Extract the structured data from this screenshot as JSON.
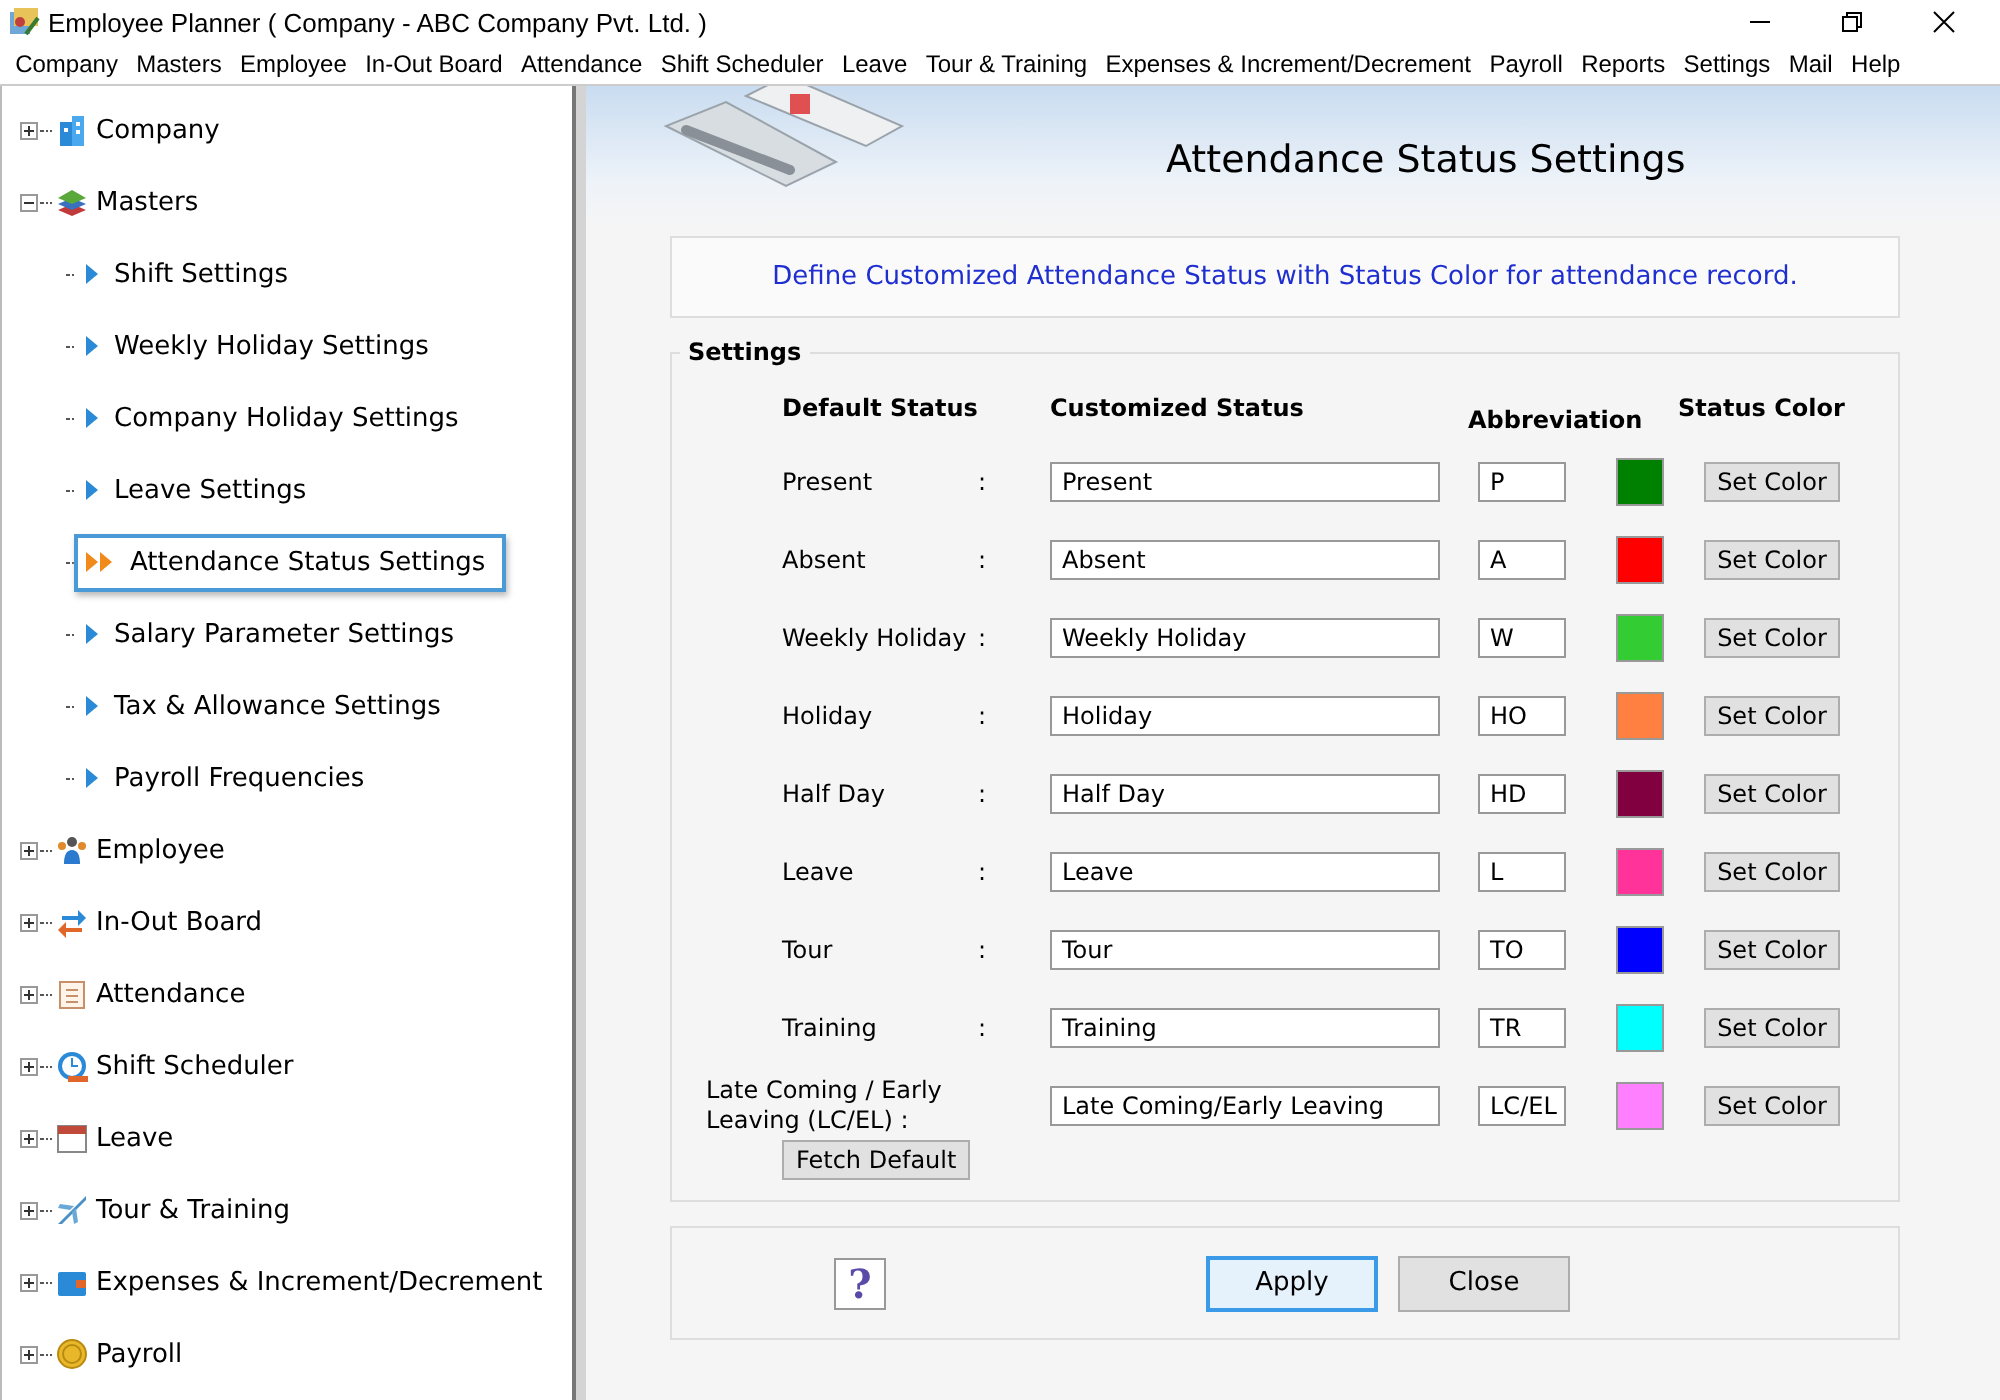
{
  "window": {
    "title": "Employee Planner ( Company - ABC Company Pvt. Ltd. )"
  },
  "menu": [
    "Company",
    "Masters",
    "Employee",
    "In-Out Board",
    "Attendance",
    "Shift Scheduler",
    "Leave",
    "Tour & Training",
    "Expenses & Increment/Decrement",
    "Payroll",
    "Reports",
    "Settings",
    "Mail",
    "Help"
  ],
  "tree": [
    {
      "label": "Company",
      "expanded": false
    },
    {
      "label": "Masters",
      "expanded": true,
      "children": [
        {
          "label": "Shift Settings",
          "selected": false
        },
        {
          "label": "Weekly Holiday Settings",
          "selected": false
        },
        {
          "label": "Company Holiday Settings",
          "selected": false
        },
        {
          "label": "Leave Settings",
          "selected": false
        },
        {
          "label": "Attendance Status Settings",
          "selected": true
        },
        {
          "label": "Salary Parameter Settings",
          "selected": false
        },
        {
          "label": "Tax & Allowance Settings",
          "selected": false
        },
        {
          "label": "Payroll Frequencies",
          "selected": false
        }
      ]
    },
    {
      "label": "Employee",
      "expanded": false
    },
    {
      "label": "In-Out Board",
      "expanded": false
    },
    {
      "label": "Attendance",
      "expanded": false
    },
    {
      "label": "Shift Scheduler",
      "expanded": false
    },
    {
      "label": "Leave",
      "expanded": false
    },
    {
      "label": "Tour & Training",
      "expanded": false
    },
    {
      "label": "Expenses & Increment/Decrement",
      "expanded": false
    },
    {
      "label": "Payroll",
      "expanded": false
    }
  ],
  "page_title": "Attendance Status Settings",
  "info": "Define Customized Attendance Status with Status Color for attendance record.",
  "settings": {
    "legend": "Settings",
    "columns": [
      "Default Status",
      "Customized Status",
      "Abbreviation",
      "Status Color"
    ],
    "rows": [
      {
        "kind": "normal",
        "label": "Present",
        "colon": ":",
        "value": "Present",
        "abbreviation": "P",
        "color": "#008000",
        "button": "Set Color"
      },
      {
        "kind": "normal",
        "label": "Absent",
        "colon": ":",
        "value": "Absent",
        "abbreviation": "A",
        "color": "#ff0000",
        "button": "Set Color"
      },
      {
        "kind": "normal",
        "label": "Weekly Holiday",
        "colon": ":",
        "value": "Weekly Holiday",
        "abbreviation": "W",
        "color": "#33cc33",
        "button": "Set Color"
      },
      {
        "kind": "normal",
        "label": "Holiday",
        "colon": ":",
        "value": "Holiday",
        "abbreviation": "HO",
        "color": "#ff8040",
        "button": "Set Color"
      },
      {
        "kind": "normal",
        "label": "Half Day",
        "colon": ":",
        "value": "Half Day",
        "abbreviation": "HD",
        "color": "#800040",
        "button": "Set Color"
      },
      {
        "kind": "normal",
        "label": "Leave",
        "colon": ":",
        "value": "Leave",
        "abbreviation": "L",
        "color": "#ff3399",
        "button": "Set Color"
      },
      {
        "kind": "normal",
        "label": "Tour",
        "colon": ":",
        "value": "Tour",
        "abbreviation": "TO",
        "color": "#0000ff",
        "button": "Set Color"
      },
      {
        "kind": "normal",
        "label": "Training",
        "colon": ":",
        "value": "Training",
        "abbreviation": "TR",
        "color": "#00ffff",
        "button": "Set Color"
      },
      {
        "kind": "wide",
        "label": "Late Coming / Early Leaving (LC/EL) :",
        "value": "Late Coming/Early Leaving",
        "abbreviation": "LC/EL",
        "color": "#ff80ff",
        "button": "Set Color"
      }
    ],
    "fetch_button": "Fetch Default"
  },
  "footer": {
    "help": "?",
    "buttons": [
      {
        "label": "Apply",
        "selected": true
      },
      {
        "label": "Close",
        "selected": false
      }
    ]
  }
}
